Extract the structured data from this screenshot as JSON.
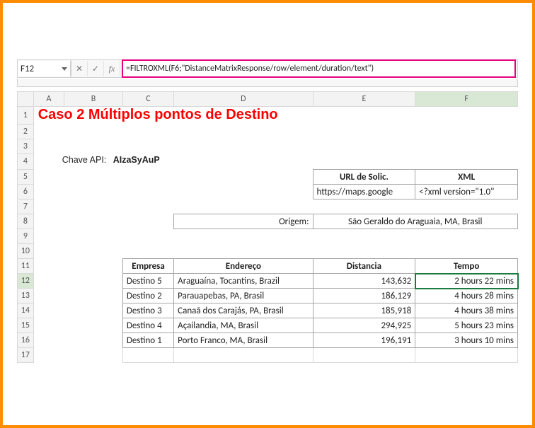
{
  "namebox": "F12",
  "formula": "=FILTROXML(F6;\"DistanceMatrixResponse/row/element/duration/text\")",
  "columns": [
    "A",
    "B",
    "C",
    "D",
    "E",
    "F"
  ],
  "row_headers": [
    "1",
    "2",
    "3",
    "4",
    "5",
    "6",
    "7",
    "8",
    "9",
    "10",
    "11",
    "12",
    "13",
    "14",
    "15",
    "16",
    "17"
  ],
  "title": "Caso 2 Múltiplos pontos de Destino",
  "chave_label": "Chave API:",
  "chave_value": "AIzaSyAuP",
  "url_hdr": "URL de Solic.",
  "xml_hdr": "XML",
  "url_val": "https://maps.google",
  "xml_val": "<?xml version=\"1.0\"",
  "origem_lbl": "Origem:",
  "origem_val": "São Geraldo do Araguaia, MA, Brasil",
  "tbl_hdr_emp": "Empresa",
  "tbl_hdr_end": "Endereço",
  "tbl_hdr_dist": "Distancia",
  "tbl_hdr_tempo": "Tempo",
  "rows": [
    {
      "emp": "Destino 5",
      "end": "Araguaína, Tocantins, Brazil",
      "dist": "143,632",
      "tempo": "2 hours 22 mins"
    },
    {
      "emp": "Destino 2",
      "end": "Parauapebas, PA, Brasil",
      "dist": "186,129",
      "tempo": "4 hours 28 mins"
    },
    {
      "emp": "Destino 3",
      "end": "Canaã dos Carajás, PA, Brasil",
      "dist": "185,918",
      "tempo": "4 hours 38 mins"
    },
    {
      "emp": "Destino 4",
      "end": "Açailandia, MA, Brasil",
      "dist": "294,925",
      "tempo": "5 hours 23 mins"
    },
    {
      "emp": "Destino 1",
      "end": "Porto Franco, MA, Brasil",
      "dist": "196,191",
      "tempo": "3 hours 10 mins"
    }
  ]
}
